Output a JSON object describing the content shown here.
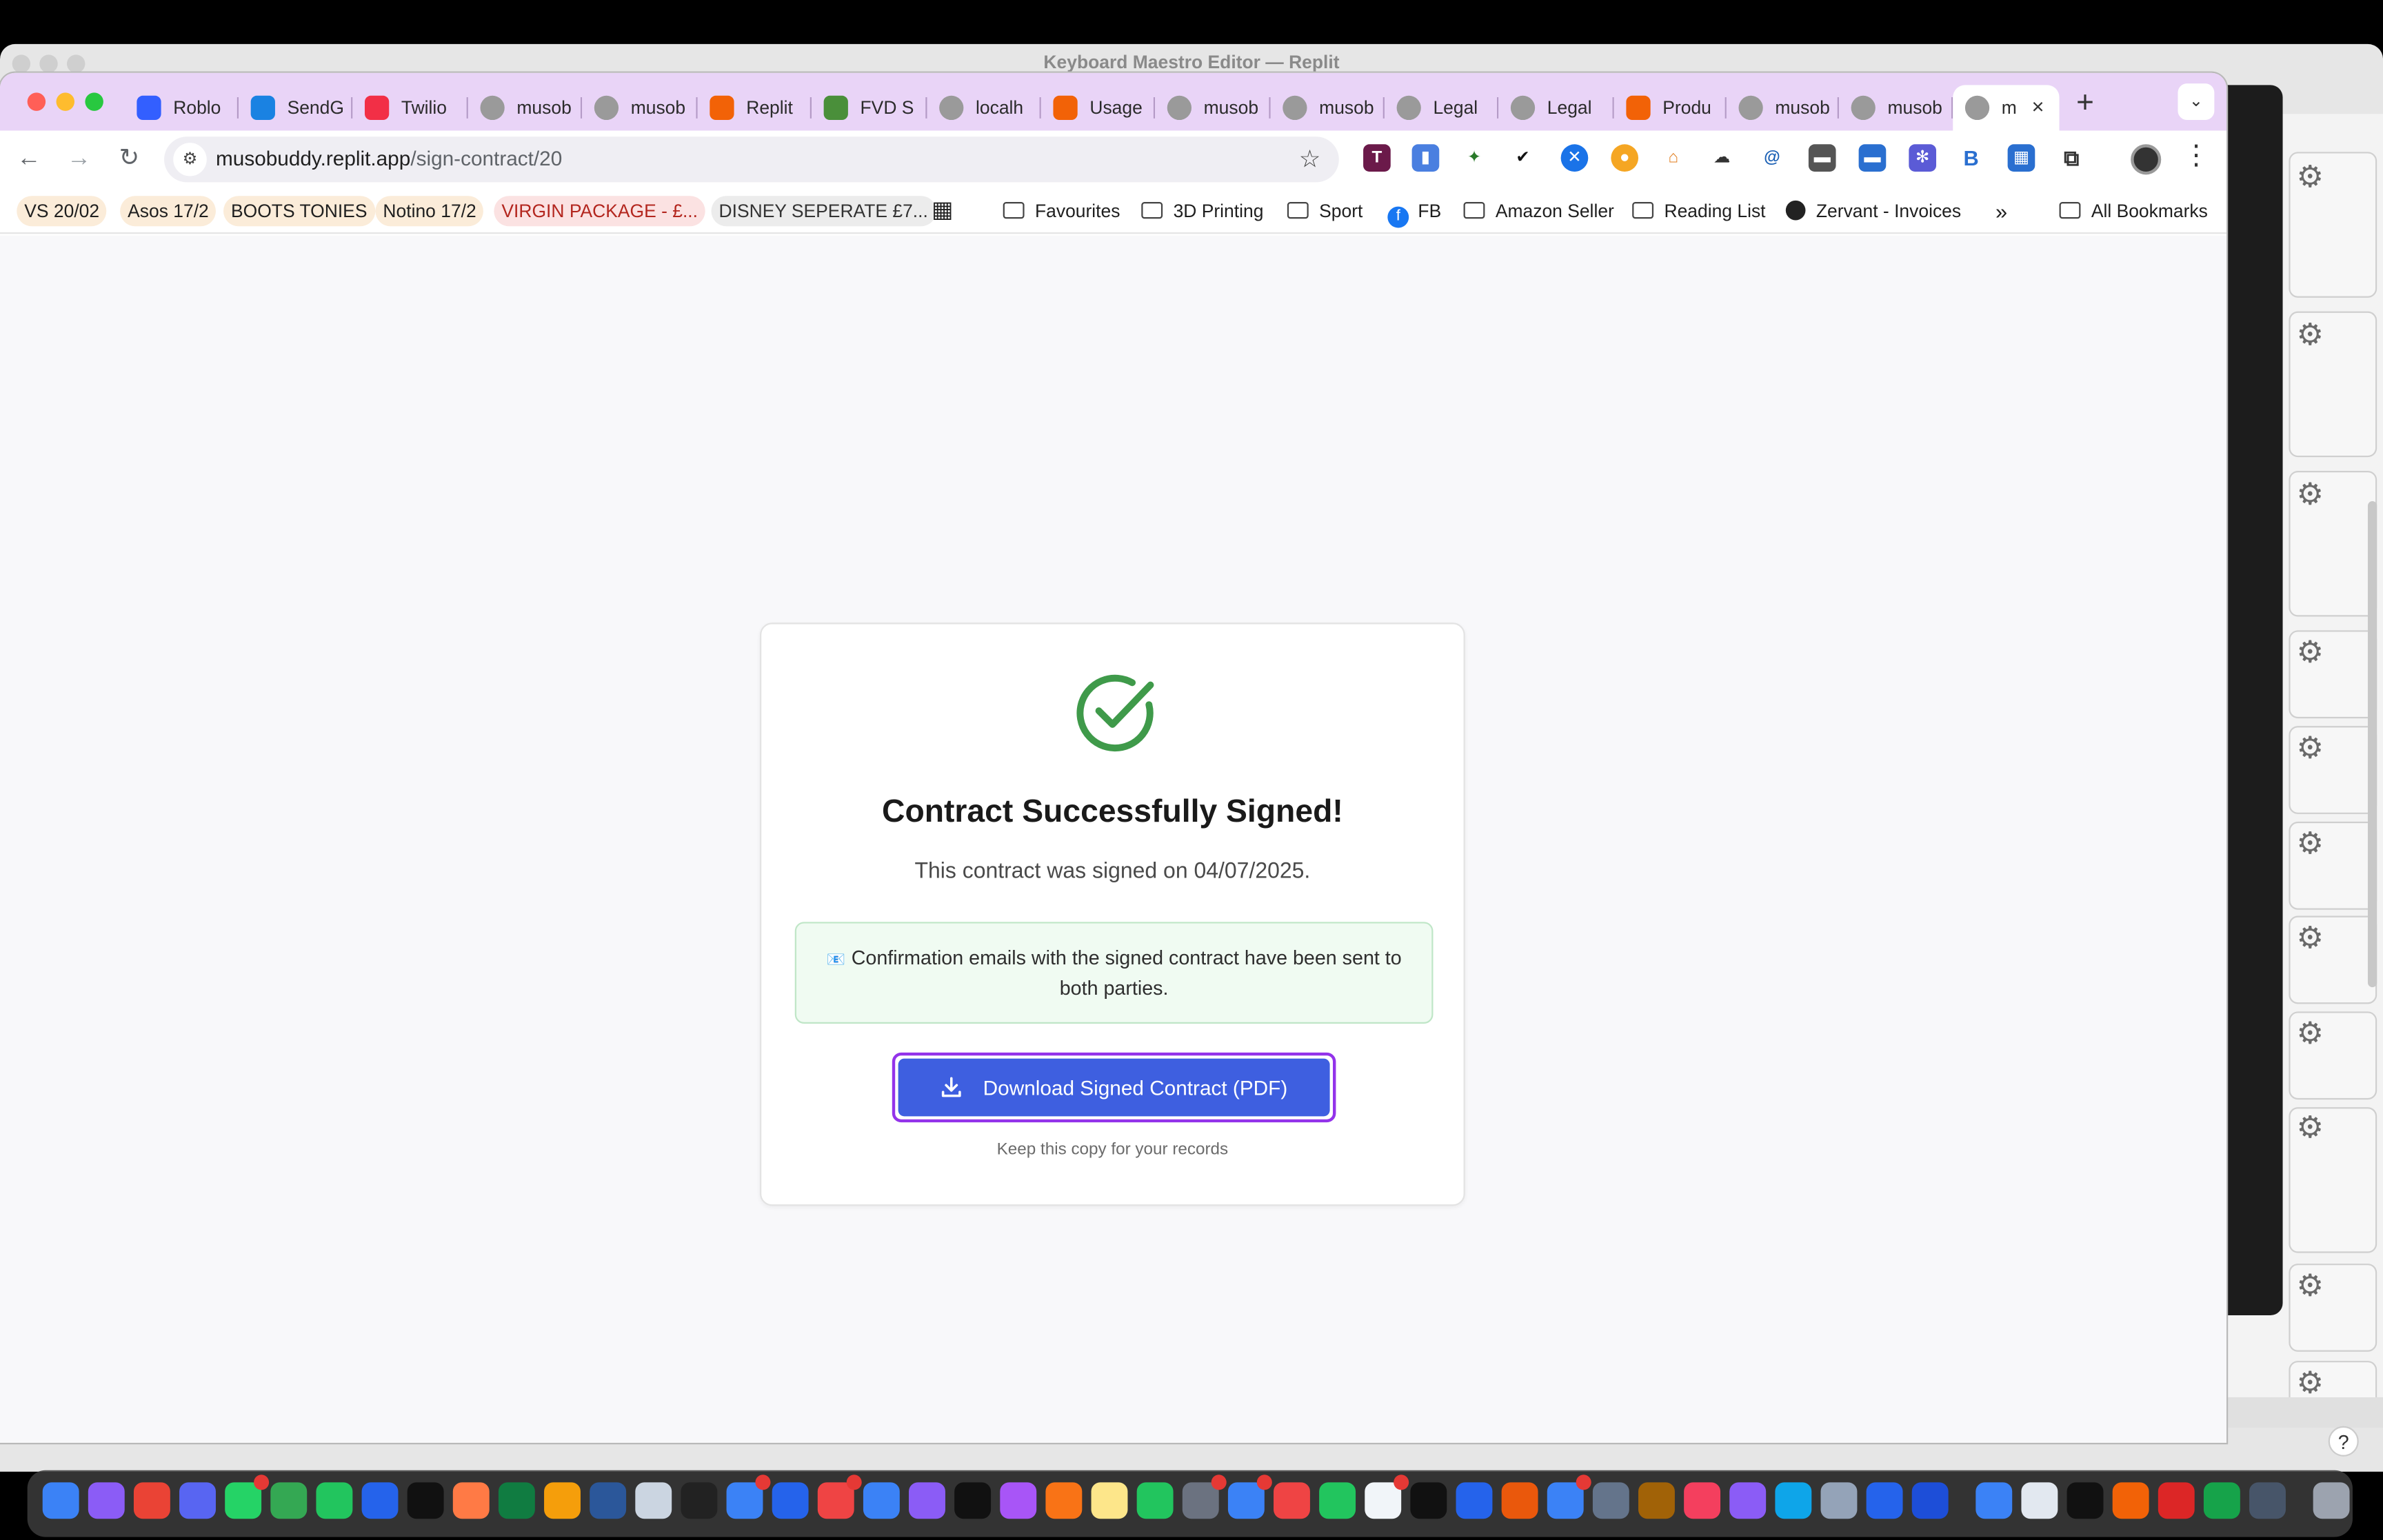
{
  "background_window": {
    "title": "Keyboard Maestro Editor — Replit",
    "help_label": "?"
  },
  "browser": {
    "tabs": [
      {
        "label": "Roblo",
        "icon": "roblox-icon",
        "color": "#335fff"
      },
      {
        "label": "SendG",
        "icon": "sendgrid-icon",
        "color": "#1a82e2"
      },
      {
        "label": "Twilio",
        "icon": "twilio-icon",
        "color": "#f22f46"
      },
      {
        "label": "musob",
        "icon": "globe-icon",
        "color": "#888888"
      },
      {
        "label": "musob",
        "icon": "globe-icon",
        "color": "#888888"
      },
      {
        "label": "Replit",
        "icon": "replit-icon",
        "color": "#f26207"
      },
      {
        "label": "FVD S",
        "icon": "fvd-icon",
        "color": "#4a8f3a"
      },
      {
        "label": "localh",
        "icon": "globe-icon",
        "color": "#888888"
      },
      {
        "label": "Usage",
        "icon": "replit-icon",
        "color": "#f26207"
      },
      {
        "label": "musob",
        "icon": "globe-icon",
        "color": "#888888"
      },
      {
        "label": "musob",
        "icon": "globe-icon",
        "color": "#888888"
      },
      {
        "label": "Legal",
        "icon": "globe-icon",
        "color": "#888888"
      },
      {
        "label": "Legal",
        "icon": "globe-icon",
        "color": "#888888"
      },
      {
        "label": "Produ",
        "icon": "replit-icon",
        "color": "#f26207"
      },
      {
        "label": "musob",
        "icon": "globe-icon",
        "color": "#888888"
      },
      {
        "label": "musob",
        "icon": "globe-icon",
        "color": "#888888"
      },
      {
        "label": "m",
        "icon": "globe-icon",
        "color": "#888888",
        "active": true
      }
    ],
    "new_tab_label": "+",
    "close_label": "×",
    "url_host": "musobuddy.replit.app",
    "url_path": "/sign-contract/20",
    "bookmarks": [
      {
        "label": "VS 20/02",
        "style": "tag"
      },
      {
        "label": "Asos 17/2",
        "style": "tag"
      },
      {
        "label": "BOOTS TONIES",
        "style": "tag"
      },
      {
        "label": "Notino 17/2",
        "style": "tag"
      },
      {
        "label": "VIRGIN PACKAGE - £...",
        "style": "red"
      },
      {
        "label": "DISNEY SEPERATE £7...",
        "style": "gray"
      },
      {
        "label": "Favourites",
        "style": "folder"
      },
      {
        "label": "3D Printing",
        "style": "folder"
      },
      {
        "label": "Sport",
        "style": "folder"
      },
      {
        "label": "FB",
        "style": "fb"
      },
      {
        "label": "Amazon Seller",
        "style": "folder"
      },
      {
        "label": "Reading List",
        "style": "folder"
      },
      {
        "label": "Zervant - Invoices",
        "style": "web"
      }
    ],
    "overflow_label": "»",
    "all_bookmarks_label": "All Bookmarks"
  },
  "page": {
    "title": "Contract Successfully Signed!",
    "signed_on": "This contract was signed on 04/07/2025.",
    "notice": "Confirmation emails with the signed contract have been sent to both parties.",
    "notice_icon": "📧",
    "download_label": "Download Signed Contract (PDF)",
    "keep_copy": "Keep this copy for your records",
    "accent_color": "#3e5fe0",
    "success_color": "#3f9a4a"
  }
}
